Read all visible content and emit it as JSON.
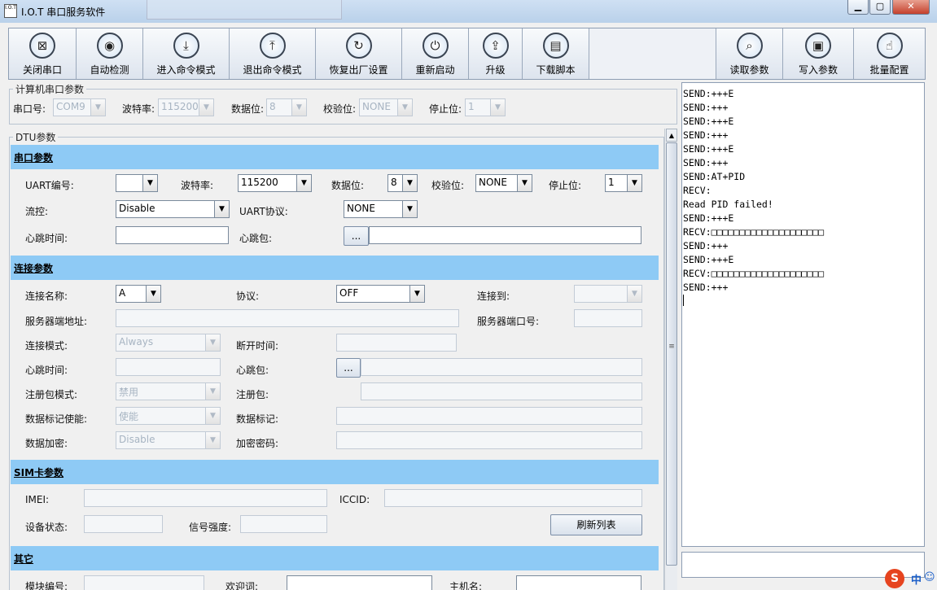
{
  "window": {
    "title": "I.O.T 串口服务软件",
    "app_icon_text": "I.O.T"
  },
  "toolbar": {
    "left_buttons": [
      {
        "label": "关闭串口",
        "icon": "close-port-icon",
        "glyph": "⊠"
      },
      {
        "label": "自动检测",
        "icon": "auto-detect-icon",
        "glyph": "◉"
      },
      {
        "label": "进入命令模式",
        "icon": "enter-command-icon",
        "glyph": "⤓"
      },
      {
        "label": "退出命令模式",
        "icon": "exit-command-icon",
        "glyph": "⤒"
      },
      {
        "label": "恢复出厂设置",
        "icon": "factory-reset-icon",
        "glyph": "↻"
      },
      {
        "label": "重新启动",
        "icon": "power-icon",
        "glyph": "⏻"
      },
      {
        "label": "升级",
        "icon": "upgrade-icon",
        "glyph": "⇪"
      },
      {
        "label": "下载脚本",
        "icon": "download-script-icon",
        "glyph": "▤"
      }
    ],
    "right_buttons": [
      {
        "label": "读取参数",
        "icon": "read-params-icon",
        "glyph": "⌕"
      },
      {
        "label": "写入参数",
        "icon": "write-params-icon",
        "glyph": "▣"
      },
      {
        "label": "批量配置",
        "icon": "batch-config-icon",
        "glyph": "☝"
      }
    ]
  },
  "pc_serial": {
    "legend": "计算机串口参数",
    "port_label": "串口号:",
    "port_value": "COM9",
    "baud_label": "波特率:",
    "baud_value": "115200",
    "databits_label": "数据位:",
    "databits_value": "8",
    "parity_label": "校验位:",
    "parity_value": "NONE",
    "stopbits_label": "停止位:",
    "stopbits_value": "1"
  },
  "dtu": {
    "legend": "DTU参数",
    "serial_section": {
      "title": "串口参数",
      "uart_label": "UART编号:",
      "uart_value": "",
      "baud_label": "波特率:",
      "baud_value": "115200",
      "databits_label": "数据位:",
      "databits_value": "8",
      "parity_label": "校验位:",
      "parity_value": "NONE",
      "stopbits_label": "停止位:",
      "stopbits_value": "1",
      "flow_label": "流控:",
      "flow_value": "Disable",
      "protocol_label": "UART协议:",
      "protocol_value": "NONE",
      "heartbeat_time_label": "心跳时间:",
      "heartbeat_time_value": "",
      "heartbeat_pkt_label": "心跳包:",
      "heartbeat_pkt_button": "...",
      "heartbeat_pkt_value": ""
    },
    "conn_section": {
      "title": "连接参数",
      "name_label": "连接名称:",
      "name_value": "A",
      "protocol_label": "协议:",
      "protocol_value": "OFF",
      "connect_to_label": "连接到:",
      "connect_to_value": "",
      "server_addr_label": "服务器端地址:",
      "server_addr_value": "",
      "server_port_label": "服务器端口号:",
      "server_port_value": "",
      "mode_label": "连接模式:",
      "mode_value": "Always",
      "disconnect_label": "断开时间:",
      "disconnect_value": "",
      "hb_time_label": "心跳时间:",
      "hb_time_value": "",
      "hb_pkt_label": "心跳包:",
      "hb_pkt_button": "...",
      "hb_pkt_value": "",
      "reg_mode_label": "注册包模式:",
      "reg_mode_value": "禁用",
      "reg_pkt_label": "注册包:",
      "reg_pkt_value": "",
      "tag_enable_label": "数据标记使能:",
      "tag_enable_value": "使能",
      "tag_label": "数据标记:",
      "tag_value": "",
      "encrypt_label": "数据加密:",
      "encrypt_value": "Disable",
      "encrypt_pwd_label": "加密密码:",
      "encrypt_pwd_value": ""
    },
    "sim_section": {
      "title": "SIM卡参数",
      "imei_label": "IMEI:",
      "imei_value": "",
      "iccid_label": "ICCID:",
      "iccid_value": "",
      "device_status_label": "设备状态:",
      "device_status_value": "",
      "signal_label": "信号强度:",
      "signal_value": "",
      "refresh_button": "刷新列表"
    },
    "other_section": {
      "title": "其它",
      "module_label": "模块编号:",
      "module_value": "",
      "welcome_label": "欢迎词:",
      "welcome_value": "",
      "hostname_label": "主机名:",
      "hostname_value": ""
    }
  },
  "log": {
    "lines": [
      "SEND:+++E",
      "SEND:+++",
      "SEND:+++E",
      "SEND:+++",
      "SEND:+++E",
      "SEND:+++",
      "SEND:AT+PID",
      "RECV:",
      "Read PID failed!",
      "SEND:+++E",
      "RECV:□□□□□□□□□□□□□□□□□□□□",
      "SEND:+++",
      "SEND:+++E",
      "RECV:□□□□□□□□□□□□□□□□□□□□",
      "SEND:+++"
    ]
  },
  "ime": {
    "logo": "S",
    "mode": "中",
    "extra": "☺"
  }
}
